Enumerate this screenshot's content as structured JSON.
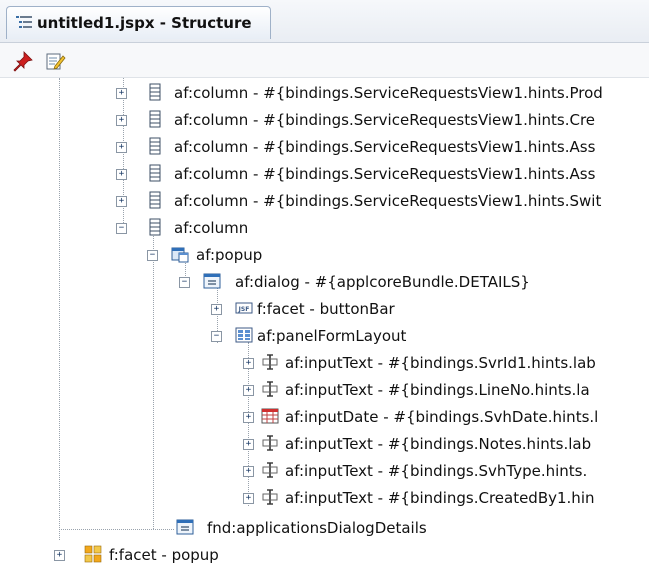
{
  "window": {
    "tab_title": "untitled1.jspx - Structure"
  },
  "toolbar": {
    "buttons": [
      "pin-icon",
      "edit-icon"
    ]
  },
  "tree": {
    "nodes": [
      {
        "label": "af:column - #{bindings.ServiceRequestsView1.hints.Prod",
        "icon": "column-icon",
        "toggle": "+"
      },
      {
        "label": "af:column - #{bindings.ServiceRequestsView1.hints.Cre",
        "icon": "column-icon",
        "toggle": "+"
      },
      {
        "label": "af:column - #{bindings.ServiceRequestsView1.hints.Ass",
        "icon": "column-icon",
        "toggle": "+"
      },
      {
        "label": "af:column - #{bindings.ServiceRequestsView1.hints.Ass",
        "icon": "column-icon",
        "toggle": "+"
      },
      {
        "label": "af:column - #{bindings.ServiceRequestsView1.hints.Swit",
        "icon": "column-icon",
        "toggle": "+"
      },
      {
        "label": "af:column",
        "icon": "column-icon",
        "toggle": "−"
      },
      {
        "label": "af:popup",
        "icon": "popup-icon",
        "toggle": "−"
      },
      {
        "label": "af:dialog - #{applcoreBundle.DETAILS}",
        "icon": "dialog-icon",
        "toggle": "−"
      },
      {
        "label": "f:facet - buttonBar",
        "icon": "jsf-facet-icon",
        "toggle": "+"
      },
      {
        "label": "af:panelFormLayout",
        "icon": "panel-form-layout-icon",
        "toggle": "−"
      },
      {
        "label": "af:inputText - #{bindings.SvrId1.hints.lab",
        "icon": "input-text-icon",
        "toggle": "+"
      },
      {
        "label": "af:inputText - #{bindings.LineNo.hints.la",
        "icon": "input-text-icon",
        "toggle": "+"
      },
      {
        "label": "af:inputDate - #{bindings.SvhDate.hints.l",
        "icon": "input-date-icon",
        "toggle": "+"
      },
      {
        "label": "af:inputText - #{bindings.Notes.hints.lab",
        "icon": "input-text-icon",
        "toggle": "+"
      },
      {
        "label": "af:inputText - #{bindings.SvhType.hints.",
        "icon": "input-text-icon",
        "toggle": "+"
      },
      {
        "label": "af:inputText - #{bindings.CreatedBy1.hin",
        "icon": "input-text-icon",
        "toggle": "+"
      },
      {
        "label": "fnd:applicationsDialogDetails",
        "icon": "dialog-icon",
        "toggle": ""
      },
      {
        "label": "f:facet - popup",
        "icon": "facet-icon",
        "toggle": "+"
      }
    ]
  }
}
